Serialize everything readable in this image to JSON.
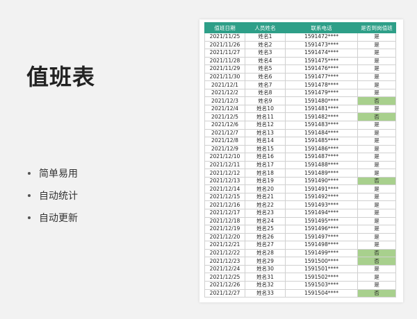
{
  "title": "值班表",
  "features": [
    "简单易用",
    "自动统计",
    "自动更新"
  ],
  "table": {
    "headers": [
      "值班日期",
      "人员姓名",
      "联系电话",
      "是否到岗值班"
    ],
    "rows": [
      [
        "2021/11/25",
        "姓名1",
        "1591472****",
        "是"
      ],
      [
        "2021/11/26",
        "姓名2",
        "1591473****",
        "是"
      ],
      [
        "2021/11/27",
        "姓名3",
        "1591474****",
        "是"
      ],
      [
        "2021/11/28",
        "姓名4",
        "1591475****",
        "是"
      ],
      [
        "2021/11/29",
        "姓名5",
        "1591476****",
        "是"
      ],
      [
        "2021/11/30",
        "姓名6",
        "1591477****",
        "是"
      ],
      [
        "2021/12/1",
        "姓名7",
        "1591478****",
        "是"
      ],
      [
        "2021/12/2",
        "姓名8",
        "1591479****",
        "是"
      ],
      [
        "2021/12/3",
        "姓名9",
        "1591480****",
        "否"
      ],
      [
        "2021/12/4",
        "姓名10",
        "1591481****",
        "是"
      ],
      [
        "2021/12/5",
        "姓名11",
        "1591482****",
        "否"
      ],
      [
        "2021/12/6",
        "姓名12",
        "1591483****",
        "是"
      ],
      [
        "2021/12/7",
        "姓名13",
        "1591484****",
        "是"
      ],
      [
        "2021/12/8",
        "姓名14",
        "1591485****",
        "是"
      ],
      [
        "2021/12/9",
        "姓名15",
        "1591486****",
        "是"
      ],
      [
        "2021/12/10",
        "姓名16",
        "1591487****",
        "是"
      ],
      [
        "2021/12/11",
        "姓名17",
        "1591488****",
        "是"
      ],
      [
        "2021/12/12",
        "姓名18",
        "1591489****",
        "是"
      ],
      [
        "2021/12/13",
        "姓名19",
        "1591490****",
        "否"
      ],
      [
        "2021/12/14",
        "姓名20",
        "1591491****",
        "是"
      ],
      [
        "2021/12/15",
        "姓名21",
        "1591492****",
        "是"
      ],
      [
        "2021/12/16",
        "姓名22",
        "1591493****",
        "是"
      ],
      [
        "2021/12/17",
        "姓名23",
        "1591494****",
        "是"
      ],
      [
        "2021/12/18",
        "姓名24",
        "1591495****",
        "是"
      ],
      [
        "2021/12/19",
        "姓名25",
        "1591496****",
        "是"
      ],
      [
        "2021/12/20",
        "姓名26",
        "1591497****",
        "是"
      ],
      [
        "2021/12/21",
        "姓名27",
        "1591498****",
        "是"
      ],
      [
        "2021/12/22",
        "姓名28",
        "1591499****",
        "否"
      ],
      [
        "2021/12/23",
        "姓名29",
        "1591500****",
        "否"
      ],
      [
        "2021/12/24",
        "姓名30",
        "1591501****",
        "是"
      ],
      [
        "2021/12/25",
        "姓名31",
        "1591502****",
        "是"
      ],
      [
        "2021/12/26",
        "姓名32",
        "1591503****",
        "是"
      ],
      [
        "2021/12/27",
        "姓名33",
        "1591504****",
        "否"
      ]
    ]
  }
}
